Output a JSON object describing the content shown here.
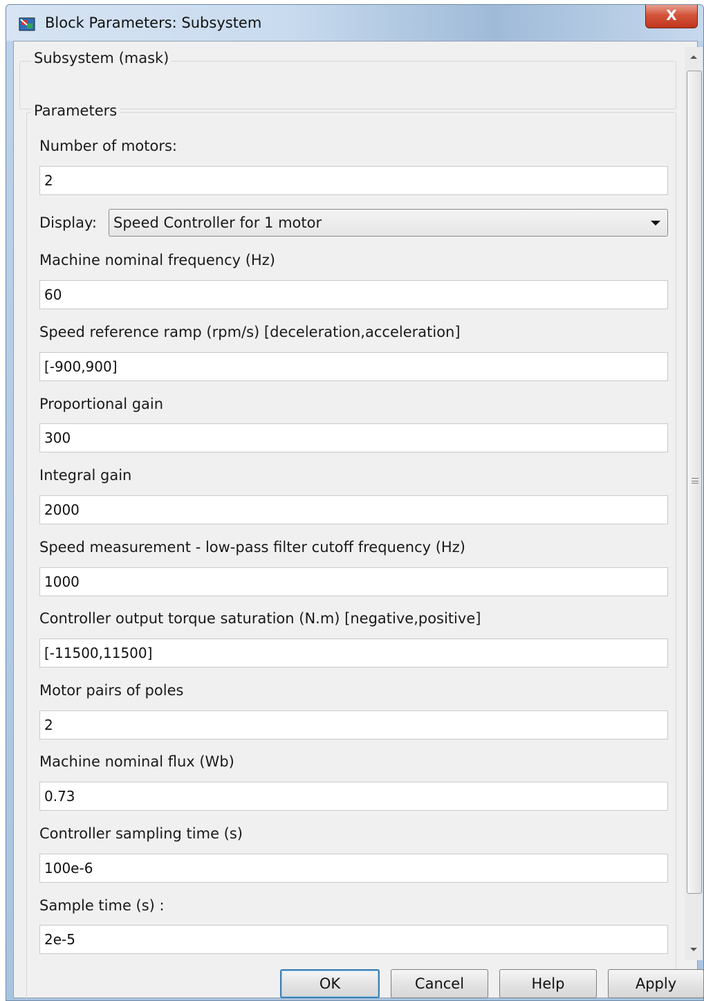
{
  "window": {
    "title": "Block Parameters: Subsystem",
    "close_glyph": "X",
    "icon": "simulink-block-icon"
  },
  "mask": {
    "title": "Subsystem (mask)"
  },
  "parameters": {
    "title": "Parameters",
    "num_motors": {
      "label": "Number of motors:",
      "value": "2"
    },
    "display": {
      "label": "Display:",
      "value": "Speed Controller for 1 motor"
    },
    "fields": [
      {
        "label": "Machine nominal frequency (Hz)",
        "value": "60"
      },
      {
        "label": "Speed reference ramp  (rpm/s) [deceleration,acceleration]",
        "value": "[-900,900]"
      },
      {
        "label": "Proportional gain",
        "value": "300"
      },
      {
        "label": "Integral gain",
        "value": "2000"
      },
      {
        "label": "Speed measurement - low-pass filter cutoff frequency (Hz)",
        "value": "1000"
      },
      {
        "label": "Controller output torque saturation (N.m) [negative,positive]",
        "value": "[-11500,11500]"
      },
      {
        "label": "Motor pairs of poles",
        "value": "2"
      },
      {
        "label": "Machine nominal flux (Wb)",
        "value": "0.73"
      },
      {
        "label": "Controller sampling time (s)",
        "value": "100e-6"
      },
      {
        "label": "Sample time (s) :",
        "value": "2e-5"
      }
    ]
  },
  "buttons": {
    "ok": "OK",
    "cancel": "Cancel",
    "help": "Help",
    "apply": "Apply"
  },
  "colors": {
    "accent": "#3c7fb1",
    "close": "#c2341c"
  }
}
